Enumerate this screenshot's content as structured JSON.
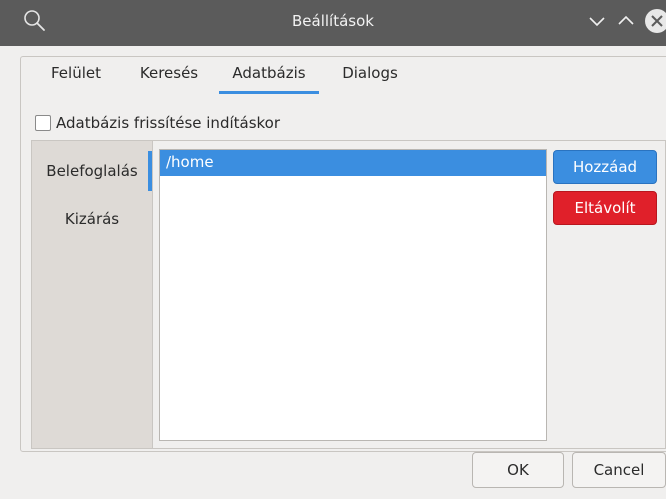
{
  "window": {
    "title": "Beállítások",
    "icons": [
      "search-icon",
      "minimize-icon",
      "maximize-icon",
      "close-icon"
    ]
  },
  "tabs": [
    {
      "label": "Felület",
      "active": false
    },
    {
      "label": "Keresés",
      "active": false
    },
    {
      "label": "Adatbázis",
      "active": true
    },
    {
      "label": "Dialogs",
      "active": false
    }
  ],
  "database": {
    "update_on_start_label": "Adatbázis frissítése indításkor",
    "update_on_start_checked": false
  },
  "sidebar": {
    "items": [
      {
        "label": "Belefoglalás",
        "active": true
      },
      {
        "label": "Kizárás",
        "active": false
      }
    ]
  },
  "paths": {
    "items": [
      "/home"
    ],
    "selected_index": 0
  },
  "actions": {
    "add_label": "Hozzáad",
    "remove_label": "Eltávolít"
  },
  "footer": {
    "ok_label": "OK",
    "cancel_label": "Cancel"
  },
  "colors": {
    "titlebar": "#5b5b5b",
    "accent": "#3b8ee0",
    "danger": "#e0202a"
  }
}
